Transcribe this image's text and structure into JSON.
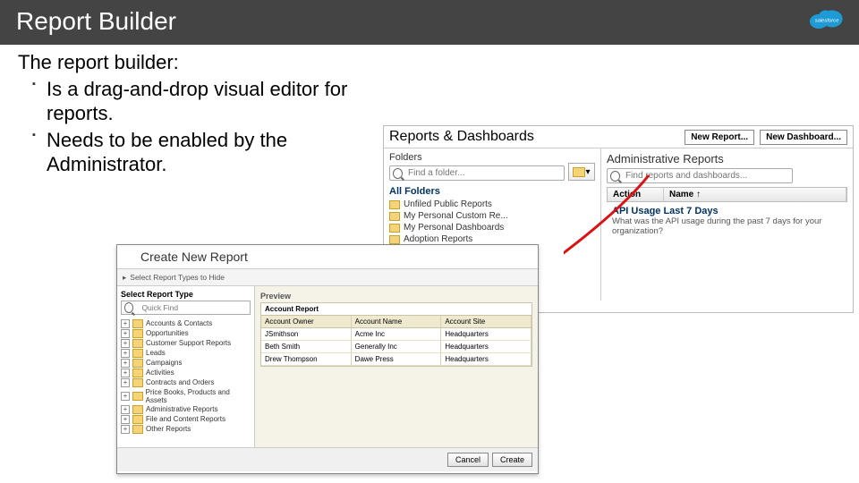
{
  "slide": {
    "title": "Report Builder",
    "intro": "The report builder:",
    "bullets": [
      "Is a drag-and-drop visual editor for reports.",
      "Needs to be enabled by the Administrator."
    ],
    "brand": "salesforce"
  },
  "reports_dashboards": {
    "heading": "Reports & Dashboards",
    "buttons": {
      "new_report": "New Report...",
      "new_dashboard": "New Dashboard..."
    },
    "folders_label": "Folders",
    "find_folder_placeholder": "Find a folder...",
    "all_folders": "All Folders",
    "folders": [
      "Unfiled Public Reports",
      "My Personal Custom Re...",
      "My Personal Dashboards",
      "Adoption Reports"
    ],
    "right_section": "Administrative Reports",
    "find_reports_placeholder": "Find reports and dashboards...",
    "columns": {
      "action": "Action",
      "name": "Name ↑"
    },
    "row": {
      "name": "API Usage Last 7 Days",
      "desc": "What was the API usage during the past 7 days for your organization?"
    }
  },
  "create_report": {
    "title": "Create New Report",
    "subtitle": "Select Report Types to Hide",
    "tree_header": "Select Report Type",
    "quick_find_placeholder": "Quick Find",
    "tree": [
      "Accounts & Contacts",
      "Opportunities",
      "Customer Support Reports",
      "Leads",
      "Campaigns",
      "Activities",
      "Contracts and Orders",
      "Price Books, Products and Assets",
      "Administrative Reports",
      "File and Content Reports",
      "Other Reports"
    ],
    "preview_label": "Preview",
    "preview_table": {
      "title": "Account Report",
      "headers": [
        "Account Owner",
        "Account Name",
        "Account Site"
      ],
      "rows": [
        [
          "JSmithson",
          "Acme Inc",
          "Headquarters"
        ],
        [
          "Beth Smith",
          "Generally Inc",
          "Headquarters"
        ],
        [
          "Drew Thompson",
          "Dawe Press",
          "Headquarters"
        ]
      ]
    },
    "buttons": {
      "cancel": "Cancel",
      "create": "Create"
    }
  }
}
